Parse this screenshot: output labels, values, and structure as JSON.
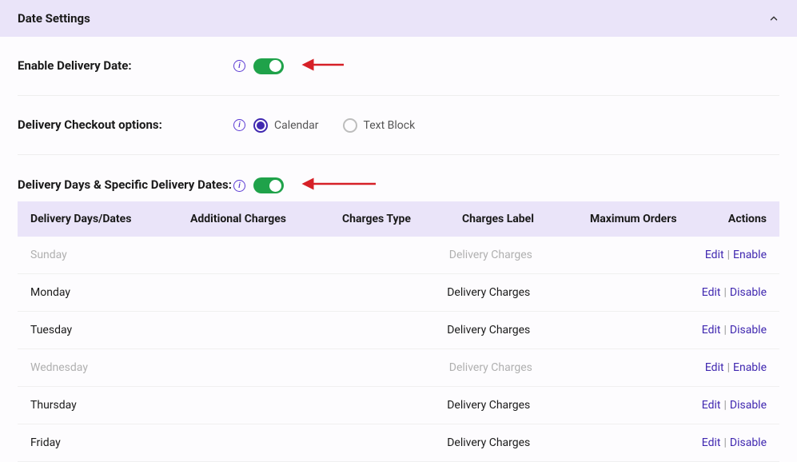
{
  "header": {
    "title": "Date Settings"
  },
  "settings": {
    "enable_label": "Enable Delivery Date:",
    "checkout_label": "Delivery Checkout options:",
    "checkout_calendar": "Calendar",
    "checkout_textblock": "Text Block",
    "days_label": "Delivery Days & Specific Delivery Dates:"
  },
  "table": {
    "headers": {
      "days": "Delivery Days/Dates",
      "additional": "Additional Charges",
      "type": "Charges Type",
      "label": "Charges Label",
      "max": "Maximum Orders",
      "actions": "Actions"
    },
    "rows": [
      {
        "day": "Sunday",
        "charges_label": "Delivery Charges",
        "edit": "Edit",
        "toggle": "Enable",
        "disabled": true
      },
      {
        "day": "Monday",
        "charges_label": "Delivery Charges",
        "edit": "Edit",
        "toggle": "Disable",
        "disabled": false
      },
      {
        "day": "Tuesday",
        "charges_label": "Delivery Charges",
        "edit": "Edit",
        "toggle": "Disable",
        "disabled": false
      },
      {
        "day": "Wednesday",
        "charges_label": "Delivery Charges",
        "edit": "Edit",
        "toggle": "Enable",
        "disabled": true
      },
      {
        "day": "Thursday",
        "charges_label": "Delivery Charges",
        "edit": "Edit",
        "toggle": "Disable",
        "disabled": false
      },
      {
        "day": "Friday",
        "charges_label": "Delivery Charges",
        "edit": "Edit",
        "toggle": "Disable",
        "disabled": false
      }
    ]
  }
}
